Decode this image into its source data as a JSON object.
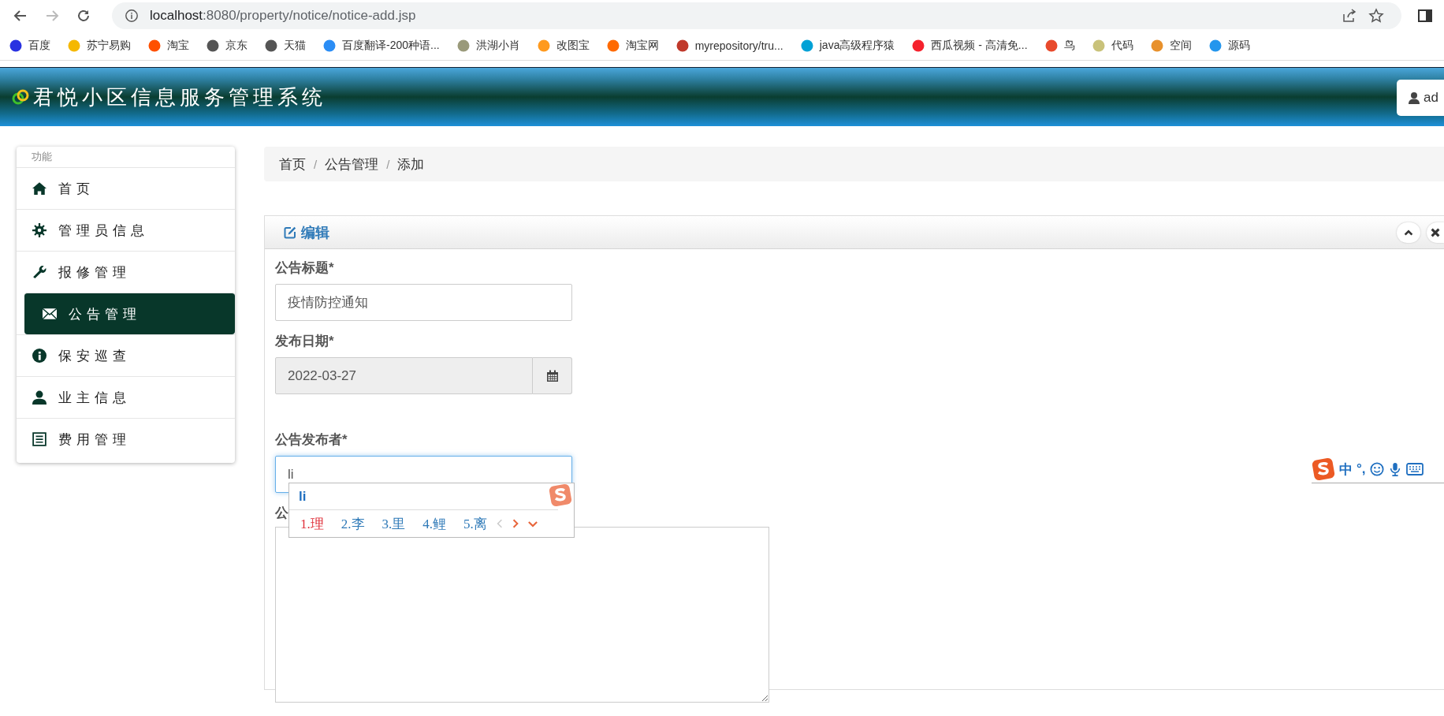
{
  "browser": {
    "url_host": "localhost",
    "url_rest": ":8080/property/notice/notice-add.jsp",
    "bookmarks": [
      {
        "label": "百度",
        "color": "#2932e1"
      },
      {
        "label": "苏宁易购",
        "color": "#f5b800"
      },
      {
        "label": "淘宝",
        "color": "#ff5000"
      },
      {
        "label": "京东",
        "color": "#555555"
      },
      {
        "label": "天猫",
        "color": "#555555"
      },
      {
        "label": "百度翻译-200种语...",
        "color": "#2b8df5"
      },
      {
        "label": "洪湖小肖",
        "color": "#9a9a7a"
      },
      {
        "label": "改图宝",
        "color": "#ff9a1e"
      },
      {
        "label": "淘宝网",
        "color": "#ff6a00"
      },
      {
        "label": "myrepository/tru...",
        "color": "#c0392b"
      },
      {
        "label": "java高级程序猿",
        "color": "#00a1d6"
      },
      {
        "label": "西瓜视频 - 高清免...",
        "color": "#f5222d"
      },
      {
        "label": "鸟",
        "color": "#e84a2c"
      },
      {
        "label": "代码",
        "color": "#c9c27a"
      },
      {
        "label": "空间",
        "color": "#e8912c"
      },
      {
        "label": "源码",
        "color": "#2496ed"
      }
    ]
  },
  "header": {
    "title": "君悦小区信息服务管理系统",
    "user": "ad"
  },
  "sidebar": {
    "heading": "功能",
    "items": [
      {
        "label": "首页",
        "kind": "home",
        "selected": false
      },
      {
        "label": "管理员信息",
        "kind": "gear",
        "selected": false
      },
      {
        "label": "报修管理",
        "kind": "wrench",
        "selected": false
      },
      {
        "label": "公告管理",
        "kind": "envelope",
        "selected": true
      },
      {
        "label": "保安巡查",
        "kind": "info",
        "selected": false
      },
      {
        "label": "业主信息",
        "kind": "user",
        "selected": false
      },
      {
        "label": "费用管理",
        "kind": "list",
        "selected": false
      }
    ]
  },
  "breadcrumb": {
    "separator": "/",
    "items": [
      "首页",
      "公告管理",
      "添加"
    ]
  },
  "panel": {
    "title": "编辑",
    "fields": [
      {
        "kind": "text",
        "label": "公告标题*",
        "value": "疫情防控通知",
        "focused": false
      },
      {
        "kind": "date",
        "label": "发布日期*",
        "value": "2022-03-27",
        "focused": false
      },
      {
        "kind": "text",
        "label": "公告发布者*",
        "value": "li",
        "focused": true
      },
      {
        "kind": "textarea",
        "label": "公",
        "focused": false
      }
    ]
  },
  "ime": {
    "composition": "li",
    "candidates": [
      {
        "label": "1.理",
        "selected": true
      },
      {
        "label": "2.李",
        "selected": false
      },
      {
        "label": "3.里",
        "selected": false
      },
      {
        "label": "4.鲤",
        "selected": false
      },
      {
        "label": "5.离",
        "selected": false
      }
    ],
    "toolbar": [
      "中",
      "°,"
    ]
  }
}
